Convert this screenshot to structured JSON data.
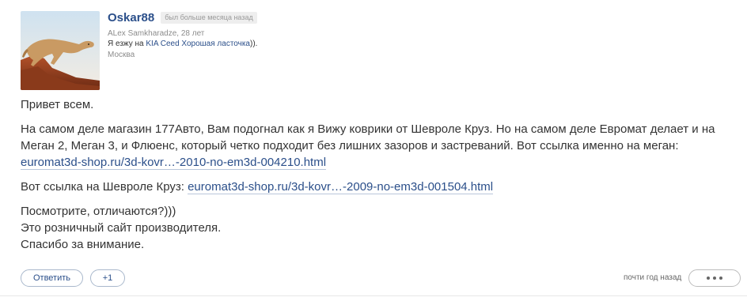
{
  "author": {
    "username": "Oskar88",
    "last_seen": "был больше месяца назад",
    "realname_age": "ALex Samkharadze, 28 лет",
    "car_prefix": "Я езжу на ",
    "car_link": "KIA Ceed Хорошая ласточка",
    "car_suffix": ")).",
    "city": "Москва",
    "avatar_icon": "cougar-photo"
  },
  "post": {
    "greeting": "Привет всем.",
    "para1_text": "На самом деле магазин 177Авто, Вам подогнал как я Вижу коврики от Шевроле Круз. Но на самом деле Евромат делает и на Меган 2, Меган 3, и Флюенс, который четко подходит без лишних зазоров и застреваний. Вот ссылка именно на меган: ",
    "para1_link": "euromat3d-shop.ru/3d-kovr…-2010-no-em3d-004210.html",
    "para2_text": "Вот ссылка на Шевроле Круз: ",
    "para2_link": "euromat3d-shop.ru/3d-kovr…-2009-no-em3d-001504.html",
    "line1": "Посмотрите, отличаются?)))",
    "line2": "Это розничный сайт производителя.",
    "line3": "Спасибо за внимание."
  },
  "actions": {
    "reply_label": "Ответить",
    "plus_label": "+1",
    "timestamp": "почти год назад",
    "more_icon": "ellipsis-icon"
  },
  "colors": {
    "link": "#2b4f8a",
    "text": "#333333",
    "muted": "#8c8c8c"
  }
}
